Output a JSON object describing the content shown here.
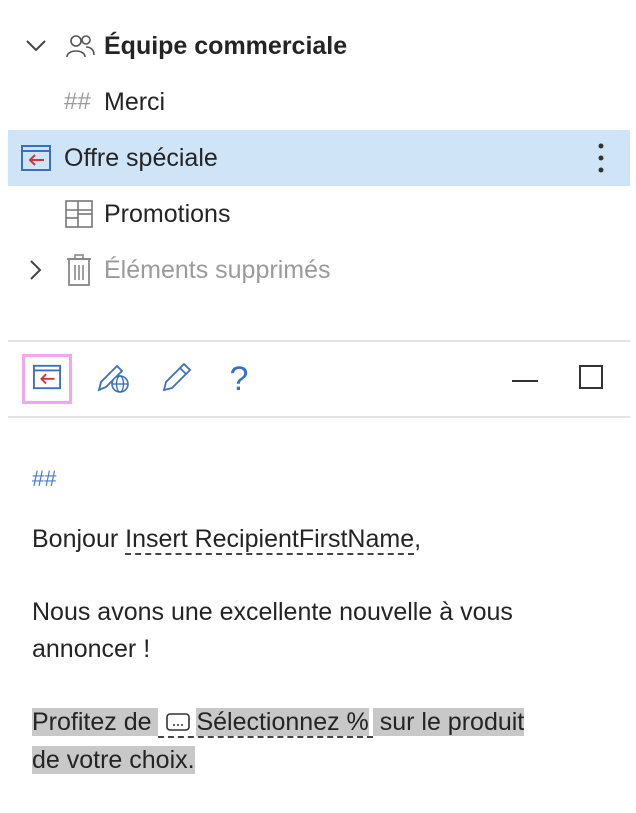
{
  "tree": {
    "group": {
      "label": "Équipe commerciale",
      "icon": "people-icon",
      "expanded": true
    },
    "items": [
      {
        "prefix": "##",
        "label": "Merci"
      },
      {
        "label": "Offre spéciale",
        "icon": "template-insert-icon",
        "selected": true
      },
      {
        "label": "Promotions",
        "icon": "table-icon"
      },
      {
        "label": "Éléments supprimés",
        "icon": "trash-icon",
        "expanded": false
      }
    ]
  },
  "toolbar": {
    "buttons": [
      {
        "name": "insert-template-icon",
        "active": true
      },
      {
        "name": "edit-web-icon"
      },
      {
        "name": "pencil-icon"
      },
      {
        "name": "help-icon",
        "glyph": "?"
      }
    ],
    "minimize": "minimize-icon",
    "maximize": "maximize-icon"
  },
  "preview": {
    "heading": "##",
    "greeting_prefix": "Bonjour ",
    "greeting_field": "Insert RecipientFirstName",
    "greeting_suffix": ",",
    "body": "Nous avons une excellente nouvelle à vous annoncer !",
    "offer_prefix": "Profitez de ",
    "offer_field": "Sélectionnez %",
    "offer_rest": " sur le produit",
    "offer_tail": "de votre choix."
  },
  "colors": {
    "selected_row": "#cfe4f6",
    "accent": "#3b6fc4",
    "icon_red": "#d13438",
    "highlight": "#c8c8c8"
  }
}
